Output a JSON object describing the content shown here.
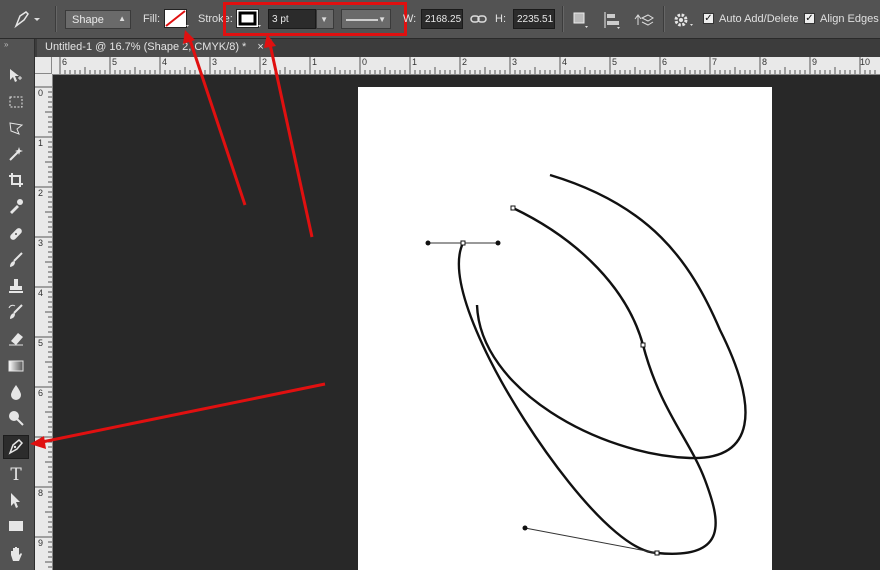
{
  "options_bar": {
    "mode_value": "Shape",
    "fill_label": "Fill:",
    "stroke_label": "Stroke:",
    "stroke_width": "3 pt",
    "w_label": "W:",
    "w_value": "2168.25",
    "h_label": "H:",
    "h_value": "2235.51",
    "auto_add_delete_label": "Auto Add/Delete",
    "auto_add_delete_checked": true,
    "align_edges_label": "Align Edges",
    "align_edges_checked": true
  },
  "document_tab": {
    "title": "Untitled-1 @ 16.7% (Shape 2, CMYK/8) *",
    "close": "×"
  },
  "rulers": {
    "horizontal": [
      "6",
      "5",
      "4",
      "3",
      "2",
      "1",
      "0",
      "1",
      "2",
      "3",
      "4",
      "5",
      "6",
      "7",
      "8",
      "9",
      "10"
    ],
    "vertical": [
      "0",
      "1",
      "2",
      "3",
      "4",
      "5",
      "6",
      "7",
      "8",
      "9"
    ]
  },
  "tools": [
    {
      "id": "move",
      "icon": "move-icon"
    },
    {
      "id": "marquee",
      "icon": "marquee-icon"
    },
    {
      "id": "lasso",
      "icon": "lasso-icon"
    },
    {
      "id": "quick-select",
      "icon": "magic-wand-icon"
    },
    {
      "id": "crop",
      "icon": "crop-icon"
    },
    {
      "id": "eyedropper",
      "icon": "eyedropper-icon"
    },
    {
      "id": "healing",
      "icon": "bandage-icon"
    },
    {
      "id": "brush",
      "icon": "brush-icon"
    },
    {
      "id": "stamp",
      "icon": "stamp-icon"
    },
    {
      "id": "history-brush",
      "icon": "history-brush-icon"
    },
    {
      "id": "eraser",
      "icon": "eraser-icon"
    },
    {
      "id": "gradient",
      "icon": "gradient-icon"
    },
    {
      "id": "blur",
      "icon": "drop-icon"
    },
    {
      "id": "dodge",
      "icon": "dodge-icon"
    },
    {
      "id": "pen",
      "icon": "pen-icon",
      "active": true
    },
    {
      "id": "type",
      "icon": "type-icon"
    },
    {
      "id": "path-select",
      "icon": "arrow-icon"
    },
    {
      "id": "shape",
      "icon": "rectangle-icon"
    },
    {
      "id": "hand",
      "icon": "hand-icon"
    }
  ],
  "colors": {
    "annotation": "#e01010",
    "canvas": "#ffffff",
    "workspace": "#282828"
  }
}
